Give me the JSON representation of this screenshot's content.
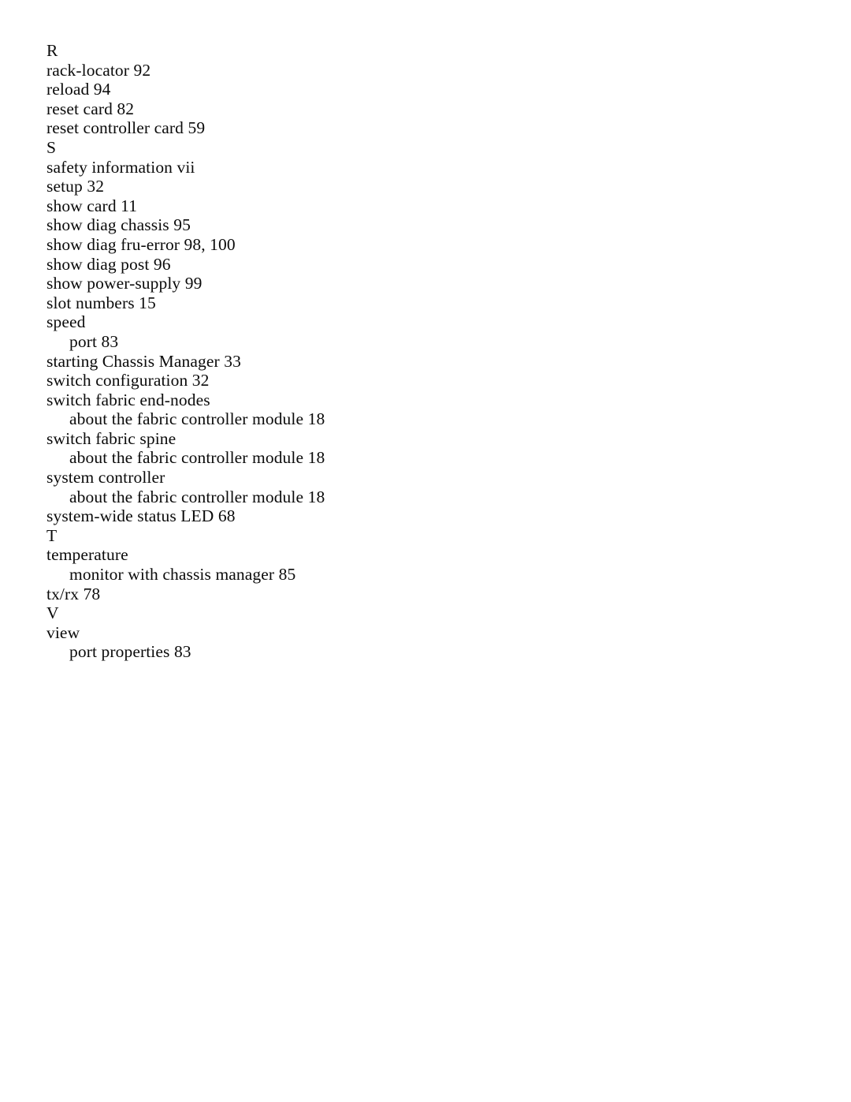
{
  "document": {
    "type": "book-index-page",
    "page_background": "#ffffff",
    "text_color": "#0b0b0b",
    "sections": [
      {
        "letter": "R",
        "entries": [
          {
            "text": "rack-locator 92",
            "level": 0
          },
          {
            "text": "reload 94",
            "level": 0
          },
          {
            "text": "reset card 82",
            "level": 0
          },
          {
            "text": "reset controller card 59",
            "level": 0
          }
        ]
      },
      {
        "letter": "S",
        "entries": [
          {
            "text": "safety information vii",
            "level": 0
          },
          {
            "text": "setup 32",
            "level": 0
          },
          {
            "text": "show card 11",
            "level": 0
          },
          {
            "text": "show diag chassis 95",
            "level": 0
          },
          {
            "text": "show diag fru-error 98, 100",
            "level": 0
          },
          {
            "text": "show diag post 96",
            "level": 0
          },
          {
            "text": "show power-supply 99",
            "level": 0
          },
          {
            "text": "slot numbers 15",
            "level": 0
          },
          {
            "text": "speed",
            "level": 0
          },
          {
            "text": "port 83",
            "level": 1
          },
          {
            "text": "starting Chassis Manager 33",
            "level": 0
          },
          {
            "text": "switch configuration 32",
            "level": 0
          },
          {
            "text": "switch fabric end-nodes",
            "level": 0
          },
          {
            "text": "about the fabric controller module 18",
            "level": 1
          },
          {
            "text": "switch fabric spine",
            "level": 0
          },
          {
            "text": "about the fabric controller module 18",
            "level": 1
          },
          {
            "text": "system controller",
            "level": 0
          },
          {
            "text": "about the fabric controller module 18",
            "level": 1
          },
          {
            "text": "system-wide status LED 68",
            "level": 0
          }
        ]
      },
      {
        "letter": "T",
        "entries": [
          {
            "text": "temperature",
            "level": 0
          },
          {
            "text": "monitor with chassis manager 85",
            "level": 1
          },
          {
            "text": "tx/rx 78",
            "level": 0
          }
        ]
      },
      {
        "letter": "V",
        "entries": [
          {
            "text": "view",
            "level": 0
          },
          {
            "text": "port properties 83",
            "level": 1
          }
        ]
      }
    ]
  }
}
